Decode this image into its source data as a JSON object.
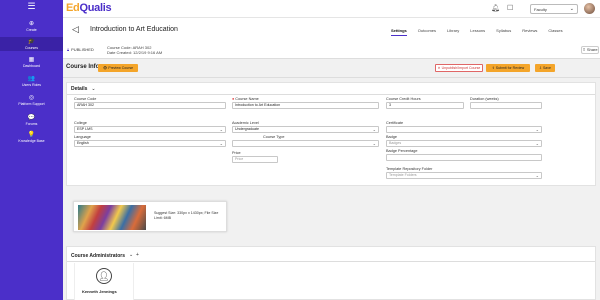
{
  "sidebar": {
    "menu_icon": "hamburger-icon",
    "items": [
      {
        "label": "Create",
        "icon": "plus-icon"
      },
      {
        "label": "Courses",
        "icon": "graduation-cap-icon"
      },
      {
        "label": "Dashboard",
        "icon": "dashboard-icon"
      },
      {
        "label": "Users Roles",
        "icon": "users-icon"
      },
      {
        "label": "Platform Support",
        "icon": "support-icon"
      },
      {
        "label": "Forums",
        "icon": "forums-icon"
      },
      {
        "label": "Knowledge Base",
        "icon": "lightbulb-icon"
      }
    ]
  },
  "topbar": {
    "logo_ed": "Ed",
    "logo_qualis": "Qualis",
    "role_select": "Faculty"
  },
  "course": {
    "title": "Introduction to Art Education",
    "status": "PUBLISHED",
    "code_line": "Course Code: ARAH 302",
    "created_line": "Date Created: 12/2/19 9:16 AM",
    "share": "Share"
  },
  "tabs": [
    "Settings",
    "Outcomes",
    "Library",
    "Lessons",
    "Syllabus",
    "Reviews",
    "Classes"
  ],
  "toolbar": {
    "section_title": "Course Info",
    "preview": "Preview Course",
    "unpublish": "Unpublish/Import Course",
    "submit_review": "Submit for Review",
    "save": "Save"
  },
  "details": {
    "title": "Details",
    "course_code": {
      "label": "Course Code",
      "value": "ARAH 302"
    },
    "course_name": {
      "label": "Course Name",
      "value": "Introduction to Art Education"
    },
    "credit_hours": {
      "label": "Course Credit Hours",
      "value": "3"
    },
    "duration": {
      "label": "Duration (weeks)",
      "value": ""
    },
    "college": {
      "label": "College",
      "value": "ESP LMS"
    },
    "academic_level": {
      "label": "Academic Level",
      "value": "Undergraduate"
    },
    "certificate": {
      "label": "Certificate",
      "value": ""
    },
    "language": {
      "label": "Language",
      "value": "English"
    },
    "course_type": {
      "label": "Course Type",
      "value": ""
    },
    "badge": {
      "label": "Badge",
      "placeholder": "Badges"
    },
    "price": {
      "label": "Price",
      "placeholder": "Price"
    },
    "badge_pct": {
      "label": "Badge Percentage",
      "value": ""
    },
    "template_folder": {
      "label": "Template Repository Folder",
      "placeholder": "Template Folders"
    }
  },
  "image": {
    "size_hint": "Suggest Size: 330px x 1430px; File Size Limit: 6MB"
  },
  "admins": {
    "title": "Course Administrators",
    "expand": "⌄",
    "add": "+",
    "people": [
      {
        "name": "Kenneth Jennings"
      }
    ]
  },
  "colors": {
    "sidebar": "#4b2fc9",
    "accent_orange": "#f4a52a",
    "danger": "#e06666"
  }
}
